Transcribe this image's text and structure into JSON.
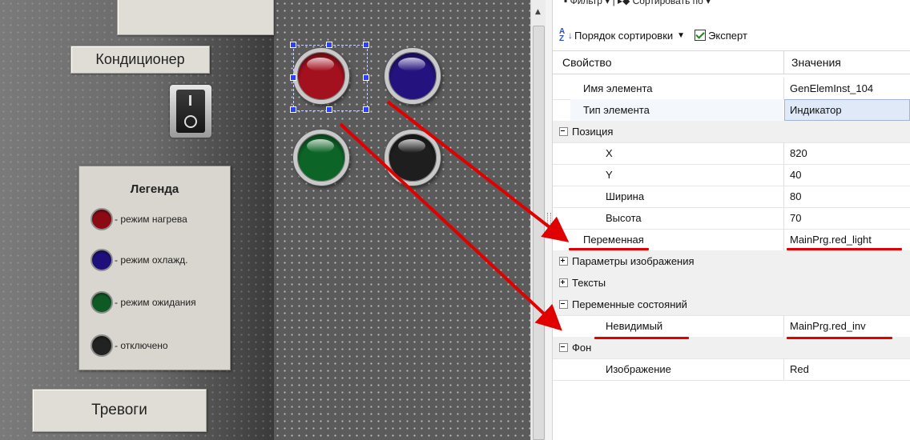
{
  "canvas": {
    "buttons": {
      "top_label": "",
      "conditioner": "Кондиционер",
      "alarms": "Тревоги"
    },
    "legend": {
      "title": "Легенда",
      "items": [
        {
          "label": "- режим нагрева",
          "color": "#8b0a14"
        },
        {
          "label": "- режим охлажд.",
          "color": "#1f0f7a"
        },
        {
          "label": "- режим ожидания",
          "color": "#0e5a24"
        },
        {
          "label": "- отключено",
          "color": "#222222"
        }
      ]
    },
    "lamps": [
      {
        "name": "red-lamp",
        "color": "#a3101e",
        "selected": true
      },
      {
        "name": "blue-lamp",
        "color": "#24137f",
        "selected": false
      },
      {
        "name": "green-lamp",
        "color": "#0d6427",
        "selected": false
      },
      {
        "name": "black-lamp",
        "color": "#1e1e1e",
        "selected": false
      }
    ]
  },
  "properties": {
    "toolbar": {
      "filter": "▪ Фильтр ▾ | ▸◆ Сортировать по ▾",
      "sort_order": "Порядок сортировки",
      "sort_icon": "az-sort-icon",
      "expert": "Эксперт",
      "expert_checked": true
    },
    "header": {
      "property": "Свойство",
      "value": "Значения"
    },
    "rows": [
      {
        "name": "Имя элемента",
        "value": "GenElemInst_104"
      },
      {
        "name": "Тип элемента",
        "value": "Индикатор"
      },
      {
        "name": "Позиция",
        "value": ""
      },
      {
        "name": "X",
        "value": "820"
      },
      {
        "name": "Y",
        "value": "40"
      },
      {
        "name": "Ширина",
        "value": "80"
      },
      {
        "name": "Высота",
        "value": "70"
      },
      {
        "name": "Переменная",
        "value": "MainPrg.red_light"
      },
      {
        "name": "Параметры изображения",
        "value": ""
      },
      {
        "name": "Тексты",
        "value": ""
      },
      {
        "name": "Переменные состояний",
        "value": ""
      },
      {
        "name": "Невидимый",
        "value": "MainPrg.red_inv"
      },
      {
        "name": "Фон",
        "value": ""
      },
      {
        "name": "Изображение",
        "value": "Red"
      }
    ]
  },
  "colors": {
    "arrow": "#e00000",
    "selection_handle": "#2f3fff"
  }
}
